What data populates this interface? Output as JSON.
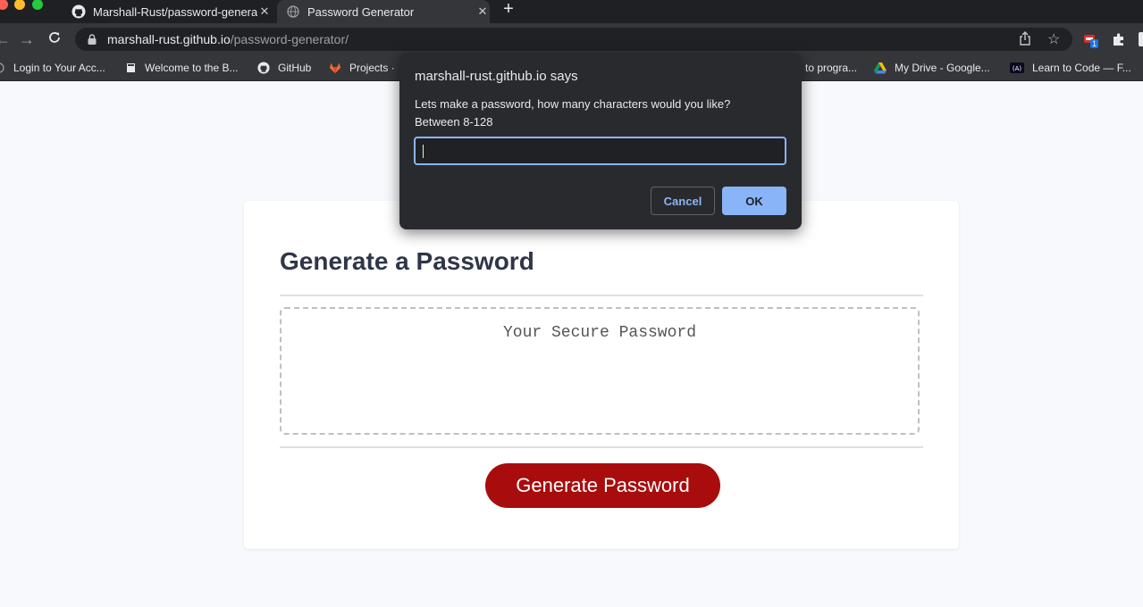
{
  "tabs": [
    {
      "title": "Marshall-Rust/password-generator",
      "icon": "github-icon",
      "active": false
    },
    {
      "title": "Password Generator",
      "icon": "globe-icon",
      "active": true
    }
  ],
  "toolbar": {
    "url_host": "marshall-rust.github.io",
    "url_path": "/password-generator/",
    "extension_badge": "1"
  },
  "bookmarks": [
    {
      "label": "Login to Your Acc...",
      "icon": "globe-icon"
    },
    {
      "label": "Welcome to the B...",
      "icon": "book-icon"
    },
    {
      "label": "GitHub",
      "icon": "github-icon"
    },
    {
      "label": "Projects ·",
      "icon": "gitlab-icon"
    },
    {
      "label": "to progra...",
      "icon": "none"
    },
    {
      "label": "My Drive - Google...",
      "icon": "google-drive-icon"
    },
    {
      "label": "Learn to Code — F...",
      "icon": "freecodecamp-icon"
    }
  ],
  "page": {
    "heading": "Generate a Password",
    "password_placeholder": "Your Secure Password",
    "generate_button": "Generate Password"
  },
  "dialog": {
    "title": "marshall-rust.github.io says",
    "message_line1": "Lets make a password, how many characters would you like?",
    "message_line2": "Between 8-128",
    "input_value": "",
    "cancel_label": "Cancel",
    "ok_label": "OK"
  },
  "colors": {
    "accent_button": "#a80c0c",
    "dialog_ok": "#8ab4f8",
    "focus_ring": "#8ab4f8"
  }
}
